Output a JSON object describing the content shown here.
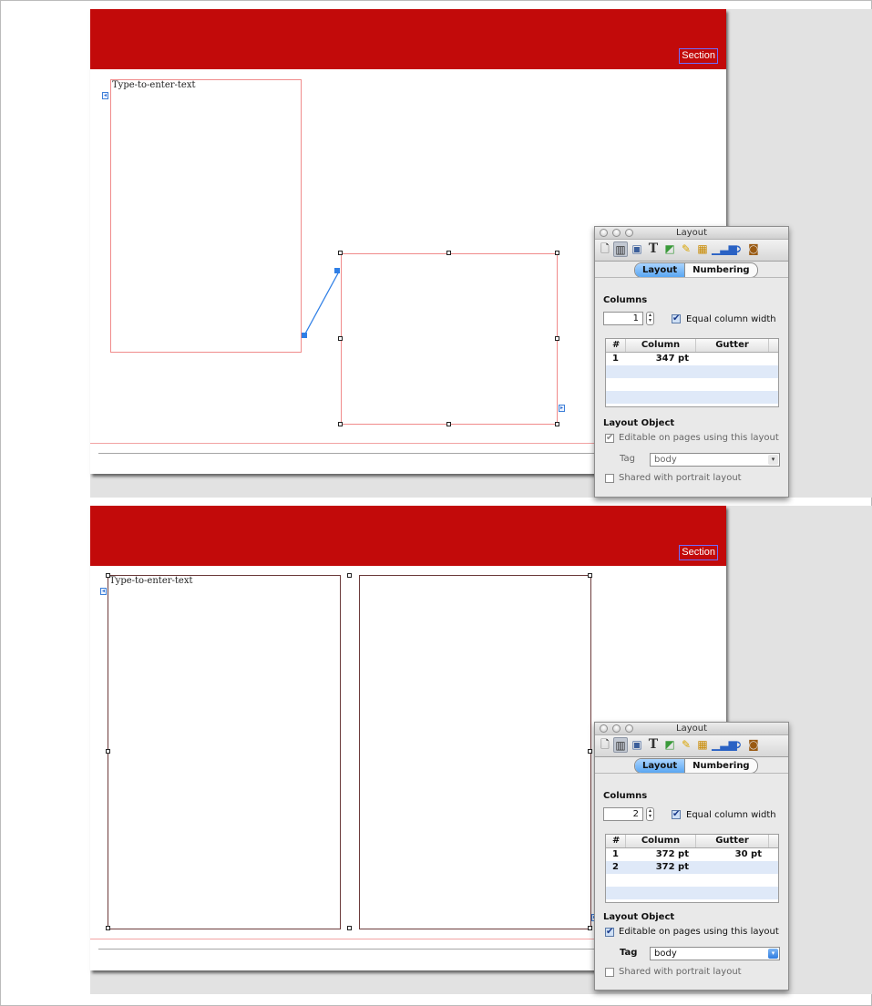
{
  "screens": [
    {
      "section_label": "Section",
      "text_box_placeholder": "Type-to-enter-text",
      "inspector": {
        "window_title": "Layout",
        "tabs": [
          "Layout",
          "Numbering"
        ],
        "columns_heading": "Columns",
        "column_count": "1",
        "equal_width_label": "Equal column width",
        "table_headers": [
          "#",
          "Column",
          "Gutter"
        ],
        "rows": [
          {
            "num": "1",
            "column": "347 pt",
            "gutter": ""
          }
        ],
        "layout_object_heading": "Layout Object",
        "editable_label": "Editable on pages using this layout",
        "tag_label": "Tag",
        "tag_value": "body",
        "shared_label": "Shared with portrait layout"
      }
    },
    {
      "section_label": "Section",
      "text_box_placeholder": "Type-to-enter-text",
      "inspector": {
        "window_title": "Layout",
        "tabs": [
          "Layout",
          "Numbering"
        ],
        "columns_heading": "Columns",
        "column_count": "2",
        "equal_width_label": "Equal column width",
        "table_headers": [
          "#",
          "Column",
          "Gutter"
        ],
        "rows": [
          {
            "num": "1",
            "column": "372 pt",
            "gutter": "30 pt"
          },
          {
            "num": "2",
            "column": "372 pt",
            "gutter": ""
          }
        ],
        "layout_object_heading": "Layout Object",
        "editable_label": "Editable on pages using this layout",
        "tag_label": "Tag",
        "tag_value": "body",
        "shared_label": "Shared with portrait layout"
      }
    }
  ],
  "colors": {
    "header_red": "#c20a0a",
    "guide_pink": "#f08b8b",
    "selection_blue": "#2f7fe6"
  },
  "icons": {
    "toolbar": [
      "document-icon",
      "layout-icon",
      "wrap-icon",
      "text-icon",
      "graphic-icon",
      "metrics-icon",
      "table-icon",
      "chart-icon",
      "link-icon",
      "media-icon"
    ]
  }
}
